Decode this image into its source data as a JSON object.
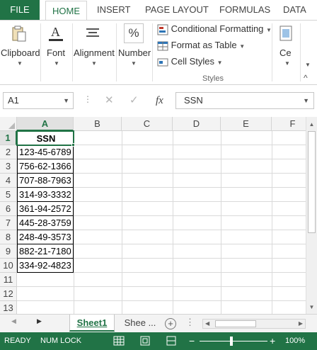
{
  "ribbon_tabs": {
    "file": "FILE",
    "home": "HOME",
    "insert": "INSERT",
    "page_layout": "PAGE LAYOUT",
    "formulas": "FORMULAS",
    "data": "DATA"
  },
  "ribbon": {
    "clipboard": "Clipboard",
    "font": "Font",
    "alignment": "Alignment",
    "number": "Number",
    "conditional_formatting": "Conditional Formatting",
    "format_as_table": "Format as Table",
    "cell_styles": "Cell Styles",
    "styles_caption": "Styles",
    "cells_partial": "Ce"
  },
  "formula_bar": {
    "name_box": "A1",
    "fx_label": "fx",
    "content": "SSN"
  },
  "columns": [
    "A",
    "B",
    "C",
    "D",
    "E",
    "F"
  ],
  "rows": [
    "1",
    "2",
    "3",
    "4",
    "5",
    "6",
    "7",
    "8",
    "9",
    "10",
    "11",
    "12",
    "13"
  ],
  "cells": {
    "A1": "SSN",
    "A2": "123-45-6789",
    "A3": "756-62-1366",
    "A4": "707-88-7963",
    "A5": "314-93-3332",
    "A6": "361-94-2572",
    "A7": "445-28-3759",
    "A8": "248-49-3573",
    "A9": "882-21-7180",
    "A10": "334-92-4823"
  },
  "sheets": {
    "active": "Sheet1",
    "other": "Shee ..."
  },
  "status": {
    "mode": "READY",
    "num_lock": "NUM LOCK",
    "zoom": "100%"
  },
  "colors": {
    "excel_green": "#217346",
    "header_gray": "#f3f3f3"
  }
}
